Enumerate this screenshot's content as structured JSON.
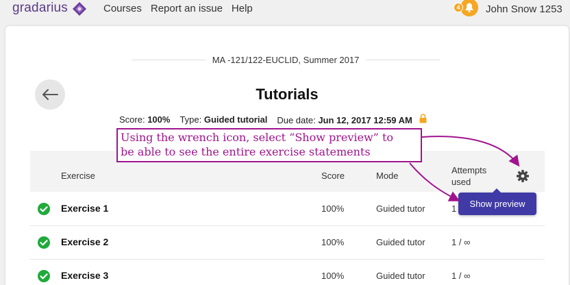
{
  "header": {
    "logo_text": "gradarius",
    "nav": [
      "Courses",
      "Report an issue",
      "Help"
    ],
    "notification_count": "4",
    "user_name": "John Snow 1253"
  },
  "page": {
    "course": "MA -121/122-EUCLID, Summer 2017",
    "title": "Tutorials",
    "score_label": "Score:",
    "score_value": "100%",
    "type_label": "Type:",
    "type_value": "Guided tutorial",
    "due_label": "Due date:",
    "due_value": "Jun 12, 2017 12:59 AM"
  },
  "table": {
    "headers": {
      "exercise": "Exercise",
      "score": "Score",
      "mode": "Mode",
      "attempts_line1": "Attempts",
      "attempts_line2": "used"
    },
    "rows": [
      {
        "name": "Exercise 1",
        "score": "100%",
        "mode": "Guided tutor",
        "attempts": "1"
      },
      {
        "name": "Exercise 2",
        "score": "100%",
        "mode": "Guided tutor",
        "attempts": "1 / ∞"
      },
      {
        "name": "Exercise 3",
        "score": "100%",
        "mode": "Guided tutor",
        "attempts": "1 / ∞"
      }
    ]
  },
  "tooltip": "Show preview",
  "annotation": {
    "line1": "Using the wrench icon, select “Show preview” to",
    "line2": "be able to see the entire exercise statements"
  },
  "colors": {
    "brand": "#5b3a8a",
    "notification": "#f5a623",
    "success": "#1faa3a",
    "tooltip_bg": "#3f3aa5",
    "annotation": "#a0138e"
  }
}
